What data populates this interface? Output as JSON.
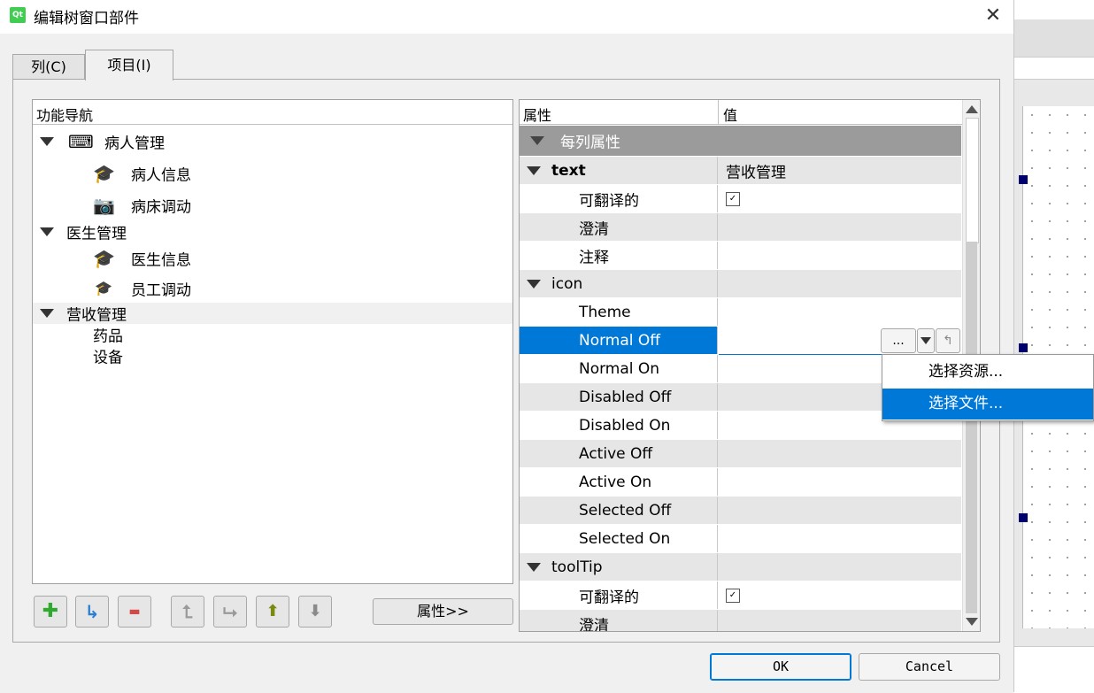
{
  "window": {
    "title": "编辑树窗口部件",
    "app_icon": "Qt",
    "close_glyph": "✕"
  },
  "tabs": [
    {
      "label": "列(C)"
    },
    {
      "label": "项目(I)"
    }
  ],
  "tree": {
    "header": "功能导航",
    "items": [
      {
        "label": "病人管理",
        "icon": "keyboard-icon",
        "glyph": "⌨"
      },
      {
        "label": "病人信息",
        "icon": "graduation-cap-icon",
        "glyph": "🎓"
      },
      {
        "label": "病床调动",
        "icon": "camera-icon",
        "glyph": "📷"
      },
      {
        "label": "医生管理"
      },
      {
        "label": "医生信息",
        "icon": "graduation-cap-icon",
        "glyph": "🎓"
      },
      {
        "label": "员工调动",
        "icon": "graduation-cap-icon",
        "glyph": "🎓"
      },
      {
        "label": "营收管理"
      },
      {
        "label": "药品"
      },
      {
        "label": "设备"
      }
    ]
  },
  "toolbar": {
    "add_glyph": "✚",
    "add_child_glyph": "↳",
    "remove_glyph": "▬",
    "move_left_glyph": "⮤",
    "move_right_glyph": "⮡",
    "move_up_glyph": "⬆",
    "move_down_glyph": "⬇",
    "properties_label": "属性>>"
  },
  "properties": {
    "header_property": "属性",
    "header_value": "值",
    "group": "每列属性",
    "rows": [
      {
        "name": "text",
        "value": "营收管理"
      },
      {
        "name": "可翻译的",
        "value": "✓"
      },
      {
        "name": "澄清",
        "value": ""
      },
      {
        "name": "注释",
        "value": ""
      },
      {
        "name": "icon",
        "value": ""
      },
      {
        "name": "Theme",
        "value": ""
      },
      {
        "name": "Normal Off",
        "value": ""
      },
      {
        "name": "Normal On",
        "value": ""
      },
      {
        "name": "Disabled Off",
        "value": ""
      },
      {
        "name": "Disabled On",
        "value": ""
      },
      {
        "name": "Active Off",
        "value": ""
      },
      {
        "name": "Active On",
        "value": ""
      },
      {
        "name": "Selected Off",
        "value": ""
      },
      {
        "name": "Selected On",
        "value": ""
      },
      {
        "name": "toolTip",
        "value": ""
      },
      {
        "name": "可翻译的",
        "value": "✓"
      },
      {
        "name": "澄清",
        "value": ""
      }
    ],
    "editor": {
      "browse_label": "...",
      "reset_glyph": "↰"
    }
  },
  "popup_menu": {
    "items": [
      "选择资源...",
      "选择文件..."
    ]
  },
  "dialog_buttons": {
    "ok": "OK",
    "cancel": "Cancel"
  },
  "colors": {
    "selection": "#0078d7",
    "group_bg": "#9b9b9b",
    "alt_row": "#e6e6e6",
    "add_green": "#2eaa2e",
    "remove_red": "#d04a4a",
    "arrow_olive": "#7a8a10"
  }
}
